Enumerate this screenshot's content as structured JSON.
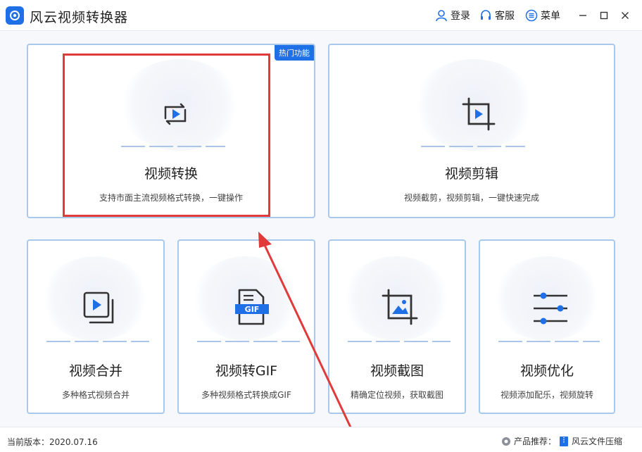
{
  "app": {
    "title": "风云视频转换器"
  },
  "header": {
    "login_label": "登录",
    "service_label": "客服",
    "menu_label": "菜单"
  },
  "cards": {
    "convert": {
      "title": "视频转换",
      "desc": "支持市面主流视频格式转换，一键操作",
      "badge": "热门功能"
    },
    "edit": {
      "title": "视频剪辑",
      "desc": "视频截剪，视频剪辑，一键快速完成"
    },
    "merge": {
      "title": "视频合并",
      "desc": "多种格式视频合并"
    },
    "gif": {
      "title": "视频转GIF",
      "desc": "多种视频格式转换成GIF"
    },
    "screenshot": {
      "title": "视频截图",
      "desc": "精确定位视频，获取截图"
    },
    "optimize": {
      "title": "视频优化",
      "desc": "视频添加配乐，视频旋转"
    }
  },
  "footer": {
    "version": "当前版本：2020.07.16",
    "promo_label": "产品推荐：",
    "promo_product": "风云文件压缩"
  },
  "colors": {
    "accent": "#1f6fe6",
    "card_border": "#a8c9ec",
    "highlight": "#e03a3a"
  }
}
